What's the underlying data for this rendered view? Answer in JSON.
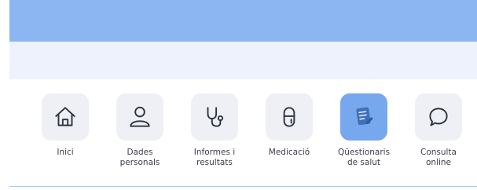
{
  "nav": {
    "items": [
      {
        "label": "Inici",
        "icon": "home-icon"
      },
      {
        "label": "Dades\npersonals",
        "icon": "user-icon"
      },
      {
        "label": "Informes i\nresultats",
        "icon": "stethoscope-icon"
      },
      {
        "label": "Medicació",
        "icon": "pill-icon"
      },
      {
        "label": "Qüestionaris\nde salut",
        "icon": "questionnaire-icon",
        "selected": true
      },
      {
        "label": "Consulta\nonline",
        "icon": "chat-bubble-icon"
      }
    ]
  },
  "colors": {
    "header": "#8cb6f2",
    "subheader": "#eef2fd",
    "tile": "#eef0f5",
    "tile_active": "#77a8ee",
    "icon_stroke": "#2d3340"
  }
}
